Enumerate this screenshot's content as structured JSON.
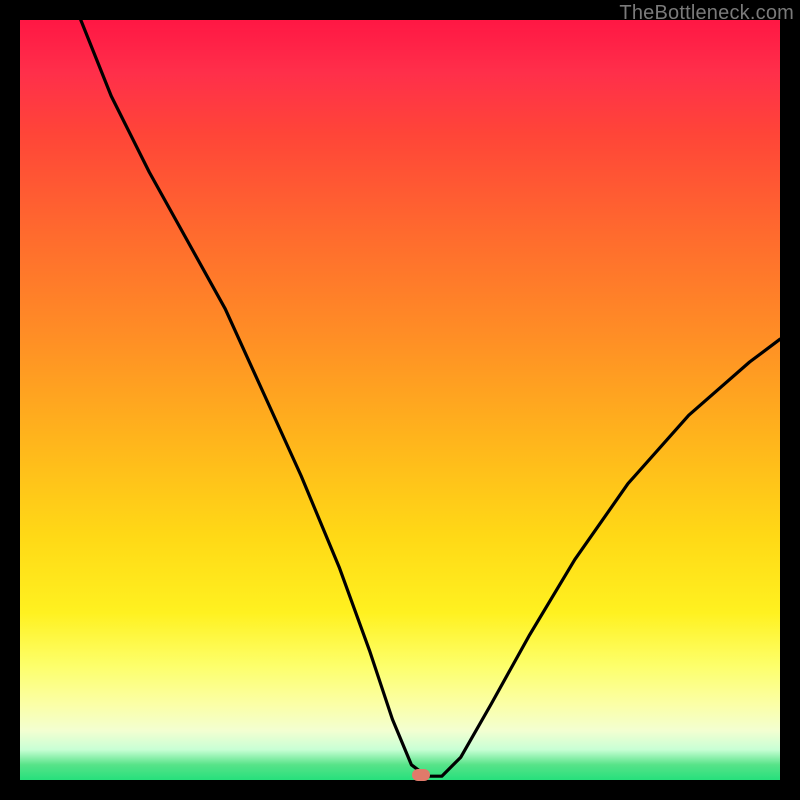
{
  "watermark": "TheBottleneck.com",
  "marker": {
    "x_pct": 52.8,
    "y_pct": 99.3
  },
  "chart_data": {
    "type": "line",
    "title": "",
    "xlabel": "",
    "ylabel": "",
    "xlim": [
      0,
      100
    ],
    "ylim": [
      0,
      100
    ],
    "grid": false,
    "legend": false,
    "colors": {
      "top": "#ff1744",
      "mid": "#ffd916",
      "bottom": "#26e07c",
      "marker": "#e07a6a",
      "curve": "#000000"
    },
    "series": [
      {
        "name": "bottleneck-curve",
        "x": [
          8.0,
          12.0,
          17.0,
          22.0,
          27.0,
          32.0,
          37.0,
          42.0,
          46.0,
          49.0,
          51.5,
          53.5,
          55.5,
          58.0,
          62.0,
          67.0,
          73.0,
          80.0,
          88.0,
          96.0,
          100.0
        ],
        "values": [
          100.0,
          90.0,
          80.0,
          71.0,
          62.0,
          51.0,
          40.0,
          28.0,
          17.0,
          8.0,
          2.0,
          0.5,
          0.5,
          3.0,
          10.0,
          19.0,
          29.0,
          39.0,
          48.0,
          55.0,
          58.0
        ]
      }
    ],
    "notes": "Background is a vertical heat gradient (red at top = high bottleneck, green at bottom = low). Black V-shaped curve shows bottleneck percentage vs. an unlabeled x-axis (likely component relative performance). The pink marker near x≈53 marks the optimal (minimum bottleneck) point."
  }
}
